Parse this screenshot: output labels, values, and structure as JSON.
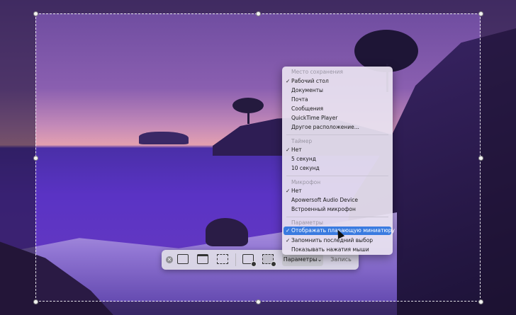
{
  "toolbar": {
    "close_icon": "close-icon",
    "options_label": "Параметры",
    "options_chevron": "⌄",
    "capture_label": "Запись"
  },
  "menu": {
    "save_section": {
      "header": "Место сохранения",
      "items": [
        {
          "label": "Рабочий стол",
          "checked": true
        },
        {
          "label": "Документы",
          "checked": false
        },
        {
          "label": "Почта",
          "checked": false
        },
        {
          "label": "Сообщения",
          "checked": false
        },
        {
          "label": "QuickTime Player",
          "checked": false
        },
        {
          "label": "Другое расположение...",
          "checked": false
        }
      ]
    },
    "timer_section": {
      "header": "Таймер",
      "items": [
        {
          "label": "Нет",
          "checked": true
        },
        {
          "label": "5 секунд",
          "checked": false
        },
        {
          "label": "10 секунд",
          "checked": false
        }
      ]
    },
    "mic_section": {
      "header": "Микрофон",
      "items": [
        {
          "label": "Нет",
          "checked": true
        },
        {
          "label": "Apowersoft Audio Device",
          "checked": false
        },
        {
          "label": "Встроенный микрофон",
          "checked": false
        }
      ]
    },
    "params_section": {
      "header": "Параметры",
      "items": [
        {
          "label": "Отображать плавающую миниатюру",
          "checked": true,
          "highlighted": true
        },
        {
          "label": "Запомнить последний выбор",
          "checked": true
        },
        {
          "label": "Показывать нажатия мыши",
          "checked": false
        }
      ]
    }
  },
  "check_glyph": "✓",
  "colors": {
    "highlight": "#3a7be0",
    "menu_bg": "#e8e2f0",
    "selection_border": "#ffffff"
  }
}
